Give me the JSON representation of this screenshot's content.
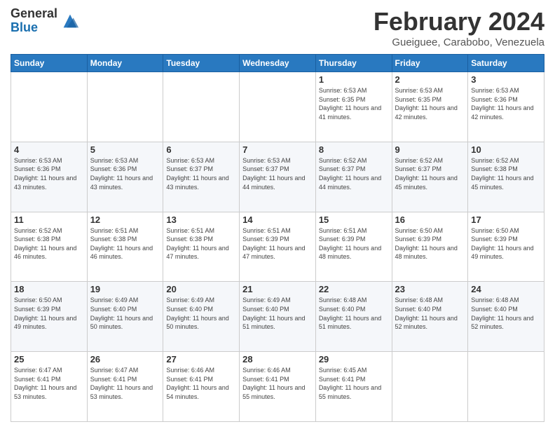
{
  "logo": {
    "general": "General",
    "blue": "Blue"
  },
  "header": {
    "title": "February 2024",
    "subtitle": "Gueiguee, Carabobo, Venezuela"
  },
  "weekdays": [
    "Sunday",
    "Monday",
    "Tuesday",
    "Wednesday",
    "Thursday",
    "Friday",
    "Saturday"
  ],
  "weeks": [
    [
      {
        "day": "",
        "info": ""
      },
      {
        "day": "",
        "info": ""
      },
      {
        "day": "",
        "info": ""
      },
      {
        "day": "",
        "info": ""
      },
      {
        "day": "1",
        "info": "Sunrise: 6:53 AM\nSunset: 6:35 PM\nDaylight: 11 hours and 41 minutes."
      },
      {
        "day": "2",
        "info": "Sunrise: 6:53 AM\nSunset: 6:35 PM\nDaylight: 11 hours and 42 minutes."
      },
      {
        "day": "3",
        "info": "Sunrise: 6:53 AM\nSunset: 6:36 PM\nDaylight: 11 hours and 42 minutes."
      }
    ],
    [
      {
        "day": "4",
        "info": "Sunrise: 6:53 AM\nSunset: 6:36 PM\nDaylight: 11 hours and 43 minutes."
      },
      {
        "day": "5",
        "info": "Sunrise: 6:53 AM\nSunset: 6:36 PM\nDaylight: 11 hours and 43 minutes."
      },
      {
        "day": "6",
        "info": "Sunrise: 6:53 AM\nSunset: 6:37 PM\nDaylight: 11 hours and 43 minutes."
      },
      {
        "day": "7",
        "info": "Sunrise: 6:53 AM\nSunset: 6:37 PM\nDaylight: 11 hours and 44 minutes."
      },
      {
        "day": "8",
        "info": "Sunrise: 6:52 AM\nSunset: 6:37 PM\nDaylight: 11 hours and 44 minutes."
      },
      {
        "day": "9",
        "info": "Sunrise: 6:52 AM\nSunset: 6:37 PM\nDaylight: 11 hours and 45 minutes."
      },
      {
        "day": "10",
        "info": "Sunrise: 6:52 AM\nSunset: 6:38 PM\nDaylight: 11 hours and 45 minutes."
      }
    ],
    [
      {
        "day": "11",
        "info": "Sunrise: 6:52 AM\nSunset: 6:38 PM\nDaylight: 11 hours and 46 minutes."
      },
      {
        "day": "12",
        "info": "Sunrise: 6:51 AM\nSunset: 6:38 PM\nDaylight: 11 hours and 46 minutes."
      },
      {
        "day": "13",
        "info": "Sunrise: 6:51 AM\nSunset: 6:38 PM\nDaylight: 11 hours and 47 minutes."
      },
      {
        "day": "14",
        "info": "Sunrise: 6:51 AM\nSunset: 6:39 PM\nDaylight: 11 hours and 47 minutes."
      },
      {
        "day": "15",
        "info": "Sunrise: 6:51 AM\nSunset: 6:39 PM\nDaylight: 11 hours and 48 minutes."
      },
      {
        "day": "16",
        "info": "Sunrise: 6:50 AM\nSunset: 6:39 PM\nDaylight: 11 hours and 48 minutes."
      },
      {
        "day": "17",
        "info": "Sunrise: 6:50 AM\nSunset: 6:39 PM\nDaylight: 11 hours and 49 minutes."
      }
    ],
    [
      {
        "day": "18",
        "info": "Sunrise: 6:50 AM\nSunset: 6:39 PM\nDaylight: 11 hours and 49 minutes."
      },
      {
        "day": "19",
        "info": "Sunrise: 6:49 AM\nSunset: 6:40 PM\nDaylight: 11 hours and 50 minutes."
      },
      {
        "day": "20",
        "info": "Sunrise: 6:49 AM\nSunset: 6:40 PM\nDaylight: 11 hours and 50 minutes."
      },
      {
        "day": "21",
        "info": "Sunrise: 6:49 AM\nSunset: 6:40 PM\nDaylight: 11 hours and 51 minutes."
      },
      {
        "day": "22",
        "info": "Sunrise: 6:48 AM\nSunset: 6:40 PM\nDaylight: 11 hours and 51 minutes."
      },
      {
        "day": "23",
        "info": "Sunrise: 6:48 AM\nSunset: 6:40 PM\nDaylight: 11 hours and 52 minutes."
      },
      {
        "day": "24",
        "info": "Sunrise: 6:48 AM\nSunset: 6:40 PM\nDaylight: 11 hours and 52 minutes."
      }
    ],
    [
      {
        "day": "25",
        "info": "Sunrise: 6:47 AM\nSunset: 6:41 PM\nDaylight: 11 hours and 53 minutes."
      },
      {
        "day": "26",
        "info": "Sunrise: 6:47 AM\nSunset: 6:41 PM\nDaylight: 11 hours and 53 minutes."
      },
      {
        "day": "27",
        "info": "Sunrise: 6:46 AM\nSunset: 6:41 PM\nDaylight: 11 hours and 54 minutes."
      },
      {
        "day": "28",
        "info": "Sunrise: 6:46 AM\nSunset: 6:41 PM\nDaylight: 11 hours and 55 minutes."
      },
      {
        "day": "29",
        "info": "Sunrise: 6:45 AM\nSunset: 6:41 PM\nDaylight: 11 hours and 55 minutes."
      },
      {
        "day": "",
        "info": ""
      },
      {
        "day": "",
        "info": ""
      }
    ]
  ]
}
